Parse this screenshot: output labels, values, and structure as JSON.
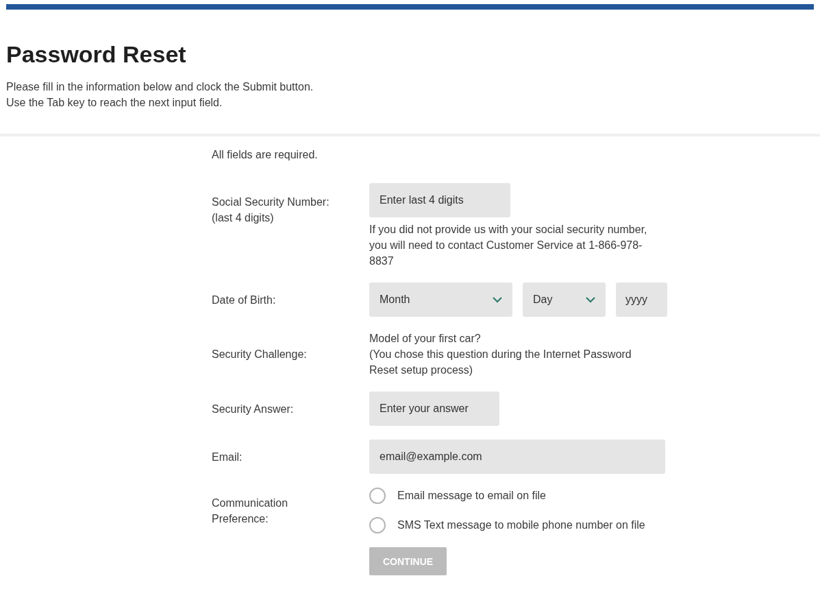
{
  "header": {
    "title": "Password Reset",
    "intro": [
      "Please fill in the information below and clock the Submit button.",
      "Use the Tab key to reach the next input field."
    ]
  },
  "form": {
    "note": "All fields are required.",
    "rows": [
      {
        "kind": "ssn",
        "label": "Social Security Number:",
        "sublabel": "(last 4 digits)",
        "placeholder": "Enter last 4 digits",
        "help": "If you did not provide us with your social security number, you will need to contact Customer Service at 1-866-978-8837"
      },
      {
        "kind": "date",
        "label": "Date of Birth:",
        "month": "Month",
        "day": "Day",
        "year": {
          "placeholder": "yyyy"
        }
      },
      {
        "kind": "challenge",
        "label": "Security Challenge:",
        "question": "Model of your first car?",
        "note": "(You chose this question during the Internet Password Reset setup process)"
      },
      {
        "kind": "answer",
        "label": "Security Answer:",
        "placeholder": "Enter your answer"
      },
      {
        "kind": "email",
        "label": "Email:",
        "placeholder": "email@example.com"
      },
      {
        "kind": "radios",
        "label": "Communication Preference:",
        "options": [
          {
            "label": "Email message to email on file",
            "checked": false
          },
          {
            "label": "SMS Text message to mobile phone number on file",
            "checked": false
          }
        ]
      }
    ],
    "button": {
      "label": "CONTINUE",
      "disabled": true
    }
  }
}
